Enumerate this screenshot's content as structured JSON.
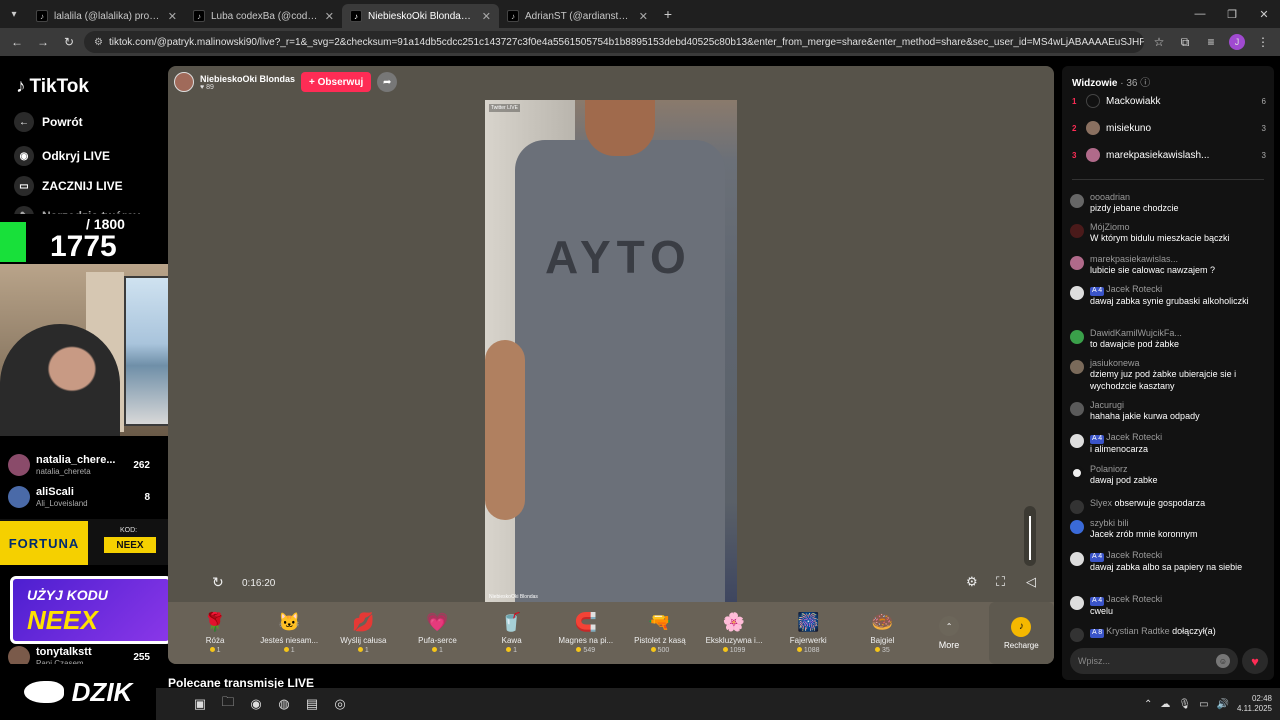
{
  "browser": {
    "tabs": [
      {
        "title": "lalalila (@lalalika) prowadzi LIVE",
        "active": false
      },
      {
        "title": "Luba codexBa (@codexba369) ...",
        "active": false
      },
      {
        "title": "NiebieskoOki Blondas (@p...",
        "active": true
      },
      {
        "title": "AdrianST (@ardianstx) prowadzi...",
        "active": false
      }
    ],
    "url": "tiktok.com/@patryk.malinowski90/live?_r=1&_svg=2&checksum=91a14db5cdcc251c143727c3f0e4a5561505754b1b8895153debd40525c80b13&enter_from_merge=share&enter_method=share&sec_user_id=MS4wLjABAAAAEuSJHPQTVIAy0lqWdeid...",
    "profile_initial": "J"
  },
  "sidebar": {
    "logo": "TikTok",
    "items": [
      {
        "label": "Powrót",
        "icon": "back-arrow-icon"
      },
      {
        "label": "Odkryj LIVE",
        "icon": "live-icon"
      },
      {
        "label": "ZACZNIJ LIVE",
        "icon": "camera-icon"
      },
      {
        "label": "Narzędzia twórcy",
        "icon": "tools-icon"
      }
    ],
    "creators": [
      {
        "name": "natalia_chere...",
        "handle": "natalia_chereta",
        "count": "262"
      },
      {
        "name": "aliScali",
        "handle": "Ali_Loveisland",
        "count": "8"
      },
      {
        "name": "tonytalkstt",
        "handle": "Pani Czasem",
        "count": "255"
      }
    ]
  },
  "overlay": {
    "counter_max": "/ 1800",
    "counter_current": "1775",
    "fortuna": "FORTUNA",
    "kod_label": "KOD:",
    "kod": "NEEX",
    "promo_line1": "UŻYJ KODU",
    "promo_line2": "NEEX",
    "brand": "DZIK"
  },
  "stream": {
    "host_name": "NiebieskoOki Blondas",
    "host_likes": "89",
    "follow_label": "+ Obserwuj",
    "time": "0:16:20",
    "shirt_print": "AYTO",
    "watermark": "Twitter LIVE",
    "watermark_bottom": "NiebieskoOki Blondas",
    "gifts": [
      {
        "name": "Róża",
        "price": "1",
        "icon": "rose-icon",
        "glyph": "🌹"
      },
      {
        "name": "Jesteś niesam...",
        "price": "1",
        "icon": "cat-icon",
        "glyph": "🐱"
      },
      {
        "name": "Wyślij całusa",
        "price": "1",
        "icon": "lips-icon",
        "glyph": "💋"
      },
      {
        "name": "Pufa-serce",
        "price": "1",
        "icon": "heart-puff-icon",
        "glyph": "💗"
      },
      {
        "name": "Kawa",
        "price": "1",
        "icon": "coffee-icon",
        "glyph": "🥤"
      },
      {
        "name": "Magnes na pi...",
        "price": "549",
        "icon": "magnet-icon",
        "glyph": "🧲"
      },
      {
        "name": "Pistolet z kasą",
        "price": "500",
        "icon": "money-gun-icon",
        "glyph": "🔫"
      },
      {
        "name": "Ekskluzywna i...",
        "price": "1099",
        "icon": "flower-icon",
        "glyph": "🌸"
      },
      {
        "name": "Fajerwerki",
        "price": "1088",
        "icon": "fireworks-icon",
        "glyph": "🎆"
      },
      {
        "name": "Bajgiel",
        "price": "35",
        "icon": "bagel-icon",
        "glyph": "🍩"
      }
    ],
    "more_label": "More",
    "recharge_label": "Recharge"
  },
  "below_title": "Polecane transmisje LIVE",
  "chat": {
    "viewers_label": "Widzowie",
    "viewers_count": "· 36",
    "top_viewers": [
      {
        "rank": "1",
        "name": "Mackowiakk",
        "score": "6"
      },
      {
        "rank": "2",
        "name": "misiekuno",
        "score": "3"
      },
      {
        "rank": "3",
        "name": "marekpasiekawislash...",
        "score": "3"
      }
    ],
    "messages": [
      {
        "user": "oooadrian",
        "text": "pizdy jebane chodzcie",
        "badge": ""
      },
      {
        "user": "MójZiomo",
        "text": "W którym bidulu mieszkacie bączki",
        "badge": ""
      },
      {
        "user": "marekpasiekawislas...",
        "text": "lubicie sie calowac nawzajem ?",
        "badge": ""
      },
      {
        "user": "Jacek Rotecki",
        "text": "dawaj zabka synie grubaski alkoholiczki",
        "badge": "A 4"
      },
      {
        "user": "DawidKamilWujcikFa...",
        "text": "to dawajcie pod żabke",
        "badge": ""
      },
      {
        "user": "jasiukonewa",
        "text": "dziemy juz pod żabke ubierajcie sie i wychodzcie kasztany",
        "badge": ""
      },
      {
        "user": "Jacurugi",
        "text": "hahaha jakie kurwa odpady",
        "badge": ""
      },
      {
        "user": "Jacek Rotecki",
        "text": "i alimenocarza",
        "badge": "A 4"
      },
      {
        "user": "Polaniorz",
        "text": "dawaj pod zabke",
        "badge": ""
      },
      {
        "user": "Slyex",
        "text": "obserwuje gospodarza",
        "badge": ""
      },
      {
        "user": "szybki bili",
        "text": "Jacek zrób mnie koronnym",
        "badge": ""
      },
      {
        "user": "Jacek Rotecki",
        "text": "dawaj zabka albo sa papiery na siebie",
        "badge": "A 4"
      },
      {
        "user": "Jacek Rotecki",
        "text": "cwelu",
        "badge": "A 4"
      },
      {
        "user": "Krystian Radtke",
        "text": "dołączył(a)",
        "badge": "A 8"
      }
    ],
    "input_placeholder": "Wpisz..."
  },
  "taskbar": {
    "time": "02:48",
    "date": "4.11.2025"
  }
}
